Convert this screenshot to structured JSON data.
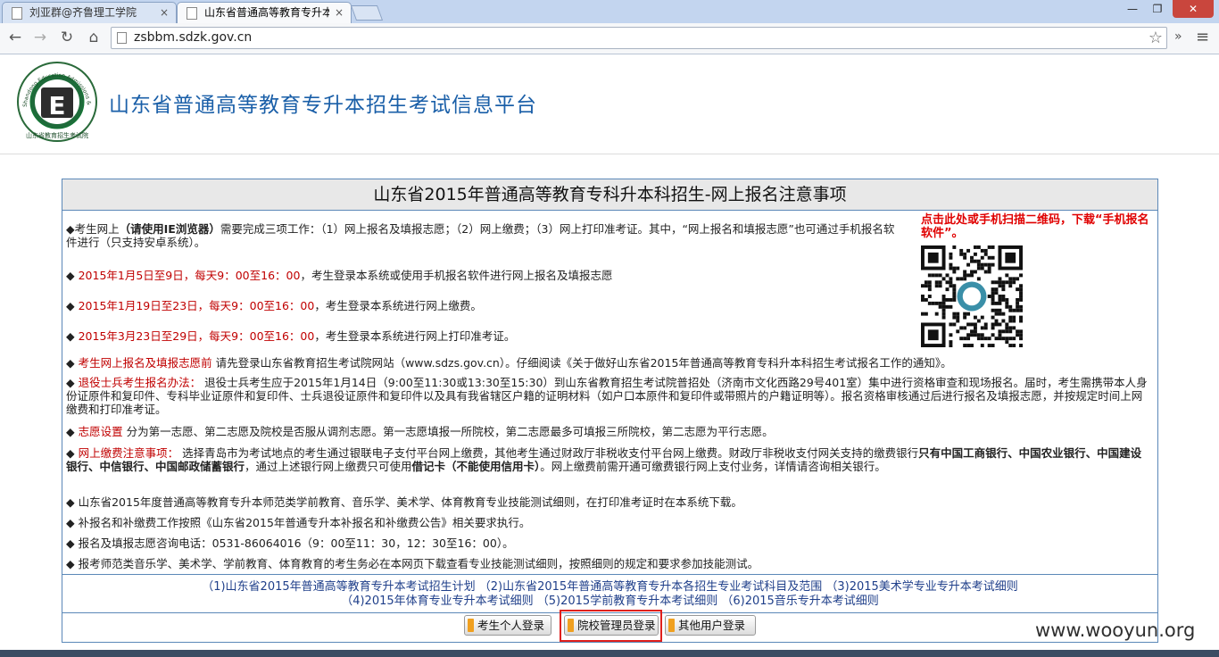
{
  "browser": {
    "tabs": [
      {
        "title": "刘亚群@齐鲁理工学院",
        "close": "×"
      },
      {
        "title": "山东省普通高等教育专升本招生",
        "close": "×"
      }
    ],
    "window_controls": {
      "minimize": "—",
      "maximize": "❐",
      "close": "✕"
    },
    "nav": {
      "back": "←",
      "forward": "→",
      "reload": "↻",
      "home": "⌂"
    },
    "url": "zsbbm.sdzk.gov.cn",
    "star": "☆",
    "more": "»",
    "menu": "≡"
  },
  "header": {
    "site_title": "山东省普通高等教育专升本招生考试信息平台",
    "logo_letter": "E",
    "logo_ring_text": "Shandong Education Admissions & Examinations",
    "logo_bottom_text": "山东省教育招生考试院"
  },
  "notice": {
    "title": "山东省2015年普通高等教育专科升本科招生-网上报名注意事项",
    "qr_caption": "点击此处或手机扫描二维码，下载“手机报名软件”。",
    "p1": {
      "a": "◆考生网上",
      "b": "（请使用IE浏览器）",
      "c": "需要完成三项工作：（1）网上报名及填报志愿；（2）网上缴费；（3）网上打印准考证。其中，“网上报名和填报志愿”也可通过手机报名软件进行（只支持安卓系统）。"
    },
    "p2": {
      "bullet": "◆ ",
      "red": "2015年1月5日至9日，每天9：00至16：00",
      "text": "，考生登录本系统或使用手机报名软件进行网上报名及填报志愿"
    },
    "p3": {
      "bullet": "◆ ",
      "red": "2015年1月19日至23日，每天9：00至16：00",
      "text": "，考生登录本系统进行网上缴费。"
    },
    "p4": {
      "bullet": "◆ ",
      "red": "2015年3月23日至29日，每天9：00至16：00",
      "text": "，考生登录本系统进行网上打印准考证。"
    },
    "p5": {
      "bullet": "◆ ",
      "red": "考生网上报名及填报志愿前",
      "text": " 请先登录山东省教育招生考试院网站（www.sdzs.gov.cn）。仔细阅读《关于做好山东省2015年普通高等教育专科升本科招生考试报名工作的通知》。"
    },
    "p6": {
      "bullet": "◆ ",
      "red": "退役士兵考生报名办法：",
      "text": " 退役士兵考生应于2015年1月14日（9:00至11:30或13:30至15:30）到山东省教育招生考试院普招处（济南市文化西路29号401室）集中进行资格审查和现场报名。届时，考生需携带本人身份证原件和复印件、专科毕业证原件和复印件、士兵退役证原件和复印件以及具有我省辖区户籍的证明材料（如户口本原件和复印件或带照片的户籍证明等）。报名资格审核通过后进行报名及填报志愿，并按规定时间上网缴费和打印准考证。"
    },
    "p7": {
      "bullet": "◆ ",
      "red": "志愿设置",
      "text": " 分为第一志愿、第二志愿及院校是否服从调剂志愿。第一志愿填报一所院校，第二志愿最多可填报三所院校，第二志愿为平行志愿。"
    },
    "p8": {
      "bullet": "◆ ",
      "red": "网上缴费注意事项：",
      "t1": " 选择青岛市为考试地点的考生通过银联电子支付平台网上缴费，其他考生通过财政厅非税收支付平台网上缴费。财政厅非税收支付网关支持的缴费银行",
      "b1": "只有中国工商银行、中国农业银行、中国建设银行、中信银行、中国邮政储蓄银行",
      "t2": "，通过上述银行网上缴费只可使用",
      "b2": "借记卡（不能使用信用卡）",
      "t3": "。网上缴费前需开通可缴费银行网上支付业务，详情请咨询相关银行。"
    },
    "p9": "◆ 山东省2015年度普通高等教育专升本师范类学前教育、音乐学、美术学、体育教育专业技能测试细则，在打印准考证时在本系统下载。",
    "p10": "◆ 补报名和补缴费工作按照《山东省2015年普通专升本补报名和补缴费公告》相关要求执行。",
    "p11": "◆ 报名及填报志愿咨询电话：0531-86064016（9：00至11：30，12：30至16：00）。",
    "p12": "◆ 报考师范类音乐学、美术学、学前教育、体育教育的考生务必在本网页下载查看专业技能测试细则，按照细则的规定和要求参加技能测试。",
    "links": [
      "（1)山东省2015年普通高等教育专升本考试招生计划",
      "（2)山东省2015年普通高等教育专升本各招生专业考试科目及范围",
      "（3)2015美术学专业专升本考试细则",
      "（4)2015年体育专业专升本考试细则",
      "（5)2015学前教育专升本考试细则",
      "（6)2015音乐专升本考试细则"
    ],
    "buttons": {
      "student": "考生个人登录",
      "admin": "院校管理员登录",
      "other": "其他用户登录"
    }
  },
  "watermark": "www.wooyun.org",
  "colors": {
    "accent_red": "#c00000",
    "title_blue": "#1a5fa8",
    "border_blue": "#5b88b8",
    "highlight": "#e0201c"
  }
}
